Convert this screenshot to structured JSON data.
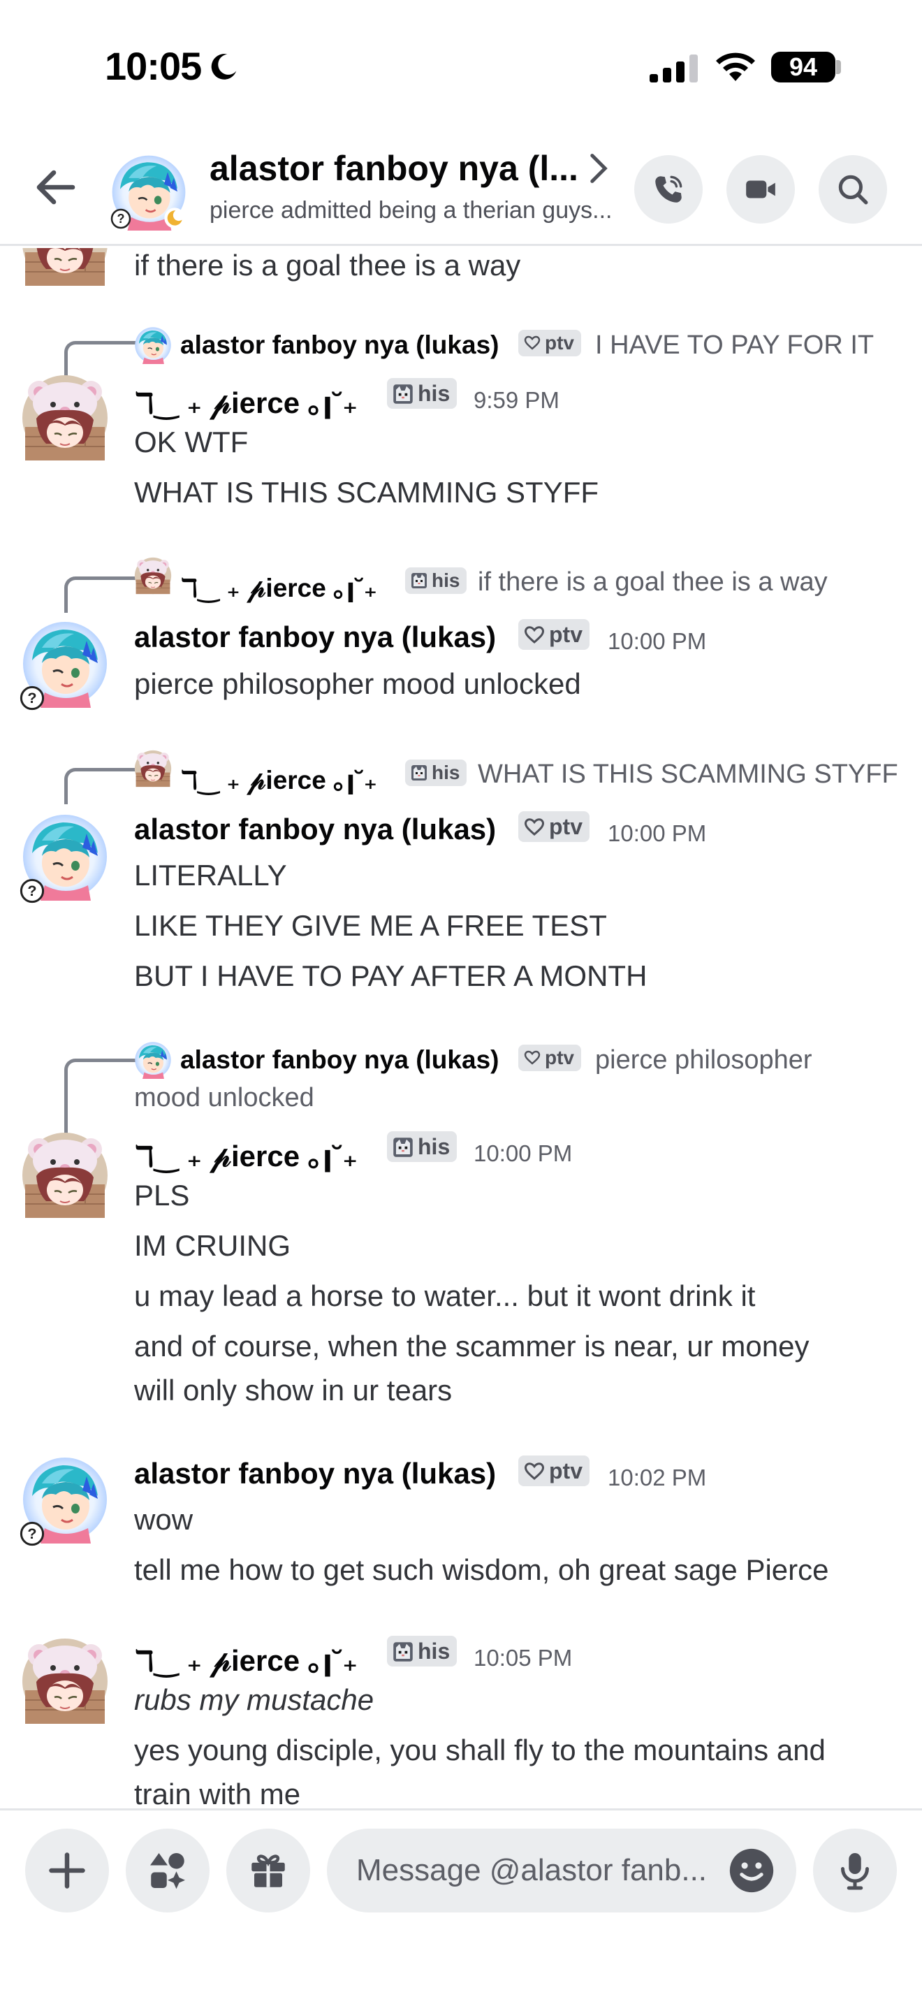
{
  "status_bar": {
    "time": "10:05",
    "battery": "94"
  },
  "header": {
    "title": "alastor fanboy nya (l...",
    "subtitle": "pierce admitted being a therian guys..."
  },
  "users": {
    "pierce": {
      "name": "ℸ‿ ₊ 𝓅ierce ｡ꞁ˘₊",
      "tag": "his"
    },
    "lukas": {
      "name": "alastor fanboy nya (lukas)",
      "tag": "ptv"
    }
  },
  "messages": {
    "top_partial": "if there is a goal thee is a way",
    "m1": {
      "reply": "I HAVE TO PAY FOR IT",
      "time": "9:59 PM",
      "lines": [
        "OK WTF",
        "WHAT IS THIS SCAMMING STYFF"
      ]
    },
    "m2": {
      "reply": "if there is a goal thee is a way",
      "time": "10:00 PM",
      "lines": [
        "pierce philosopher mood unlocked"
      ]
    },
    "m3": {
      "reply": "WHAT IS THIS SCAMMING STYFF",
      "time": "10:00 PM",
      "lines": [
        "LITERALLY",
        "LIKE THEY GIVE ME A FREE TEST",
        "BUT I HAVE TO PAY AFTER A MONTH"
      ]
    },
    "m4": {
      "reply_line1": "pierce philosopher",
      "reply_line2": "mood unlocked",
      "time": "10:00 PM",
      "lines": [
        "PLS",
        "IM CRUING",
        "u may lead a horse to water... but it wont drink it",
        "and of course, when the scammer is near, ur money",
        "will only show in ur tears"
      ]
    },
    "m5": {
      "time": "10:02 PM",
      "lines": [
        "wow",
        "tell me how to get such wisdom, oh great sage Pierce"
      ]
    },
    "m6": {
      "time": "10:05 PM",
      "lines": [
        "rubs my mustache",
        "yes young disciple, you shall fly to the mountains and",
        "train with me"
      ]
    }
  },
  "composer": {
    "placeholder": "Message @alastor fanb..."
  },
  "colors": {
    "button_bg": "#ebedef",
    "text_primary": "#060607",
    "text_muted": "#5c5e66",
    "tag_bg": "#e3e5e8",
    "reply_line": "#80848e"
  },
  "icons": [
    "moon-icon",
    "signal-icon",
    "wifi-icon",
    "back-arrow-icon",
    "chevron-right-icon",
    "phone-icon",
    "video-icon",
    "search-icon",
    "heart-icon",
    "cat-icon",
    "plus-icon",
    "apps-icon",
    "gift-icon",
    "emoji-icon",
    "mic-icon"
  ]
}
